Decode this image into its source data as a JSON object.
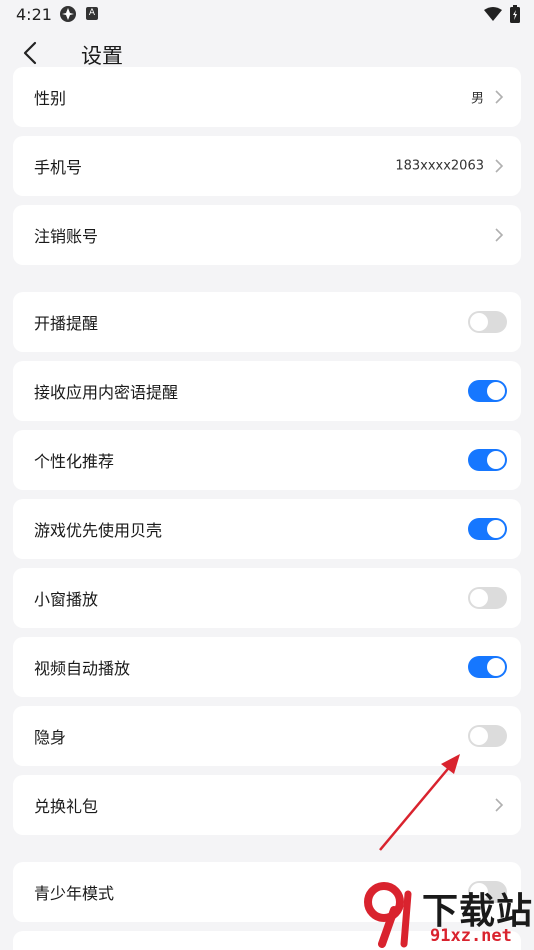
{
  "status_bar": {
    "time": "4:21",
    "icon_b": "A"
  },
  "header": {
    "title": "设置"
  },
  "rows": {
    "gender": {
      "label": "性别",
      "value": "男"
    },
    "phone": {
      "label": "手机号",
      "value": "183xxxx2063"
    },
    "cancel_account": {
      "label": "注销账号"
    },
    "live_reminder": {
      "label": "开播提醒",
      "toggle": "off"
    },
    "secret_reminder": {
      "label": "接收应用内密语提醒",
      "toggle": "on"
    },
    "personalized": {
      "label": "个性化推荐",
      "toggle": "on"
    },
    "shell_priority": {
      "label": "游戏优先使用贝壳",
      "toggle": "on"
    },
    "mini_window": {
      "label": "小窗播放",
      "toggle": "off"
    },
    "autoplay": {
      "label": "视频自动播放",
      "toggle": "on"
    },
    "invisible": {
      "label": "隐身",
      "toggle": "off"
    },
    "gift_redeem": {
      "label": "兑换礼包"
    },
    "teen_mode": {
      "label": "青少年模式",
      "toggle": "off"
    }
  },
  "watermark": {
    "text": "下载站",
    "url": "91xz.net"
  },
  "colors": {
    "accent": "#1677ff",
    "toggle_off": "#dcdcdc",
    "annotation": "#d9232e"
  }
}
